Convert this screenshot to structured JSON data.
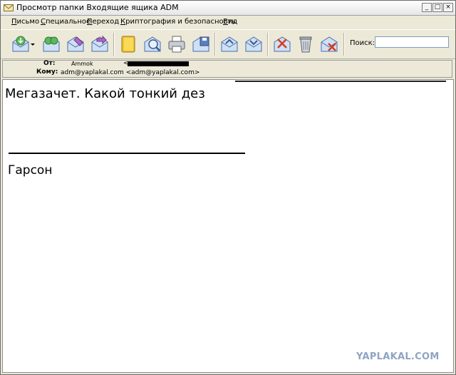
{
  "window": {
    "title": "Просмотр папки Входящие ящика ADM",
    "controls": {
      "minimize": "_",
      "maximize": "□",
      "close": "×"
    }
  },
  "menu": [
    {
      "label": "Письмо",
      "underline": "П",
      "rest": "исьмо"
    },
    {
      "label": "Специальное",
      "underline": "С",
      "rest": "пециальное"
    },
    {
      "label": "Переход",
      "underline": "П",
      "rest": "ереход"
    },
    {
      "label": "Криптография и безопасность",
      "underline": "К",
      "rest": "риптография и безопасность"
    },
    {
      "label": "Вид",
      "underline": "В",
      "rest": "ид"
    }
  ],
  "toolbar": {
    "buttons": [
      "get-mail-icon",
      "dropdown-arrow-icon",
      "move-mail-icon",
      "edit-mail-icon",
      "forward-mail-icon",
      "notebook-icon",
      "find-mail-icon",
      "print-icon",
      "save-mail-icon",
      "prev-mail-icon",
      "next-mail-icon",
      "cancel-icon",
      "trash-icon",
      "delete-mail-icon"
    ],
    "search_label": "Поиск:",
    "search_value": ""
  },
  "header": {
    "from_label": "От:",
    "from_name": "Ammok",
    "from_addr_open": "<",
    "to_label": "Кому:",
    "to_value": "adm@yaplakal.com <adm@yaplakal.com>"
  },
  "message": {
    "line1": "Мегазачет. Какой тонкий дез",
    "signature": "Гарсон"
  },
  "watermark": "YAPLAKAL.COM",
  "colors": {
    "watermark": "#8fa4c2",
    "titlebar": "#ffffff",
    "chrome": "#ece9d8"
  }
}
